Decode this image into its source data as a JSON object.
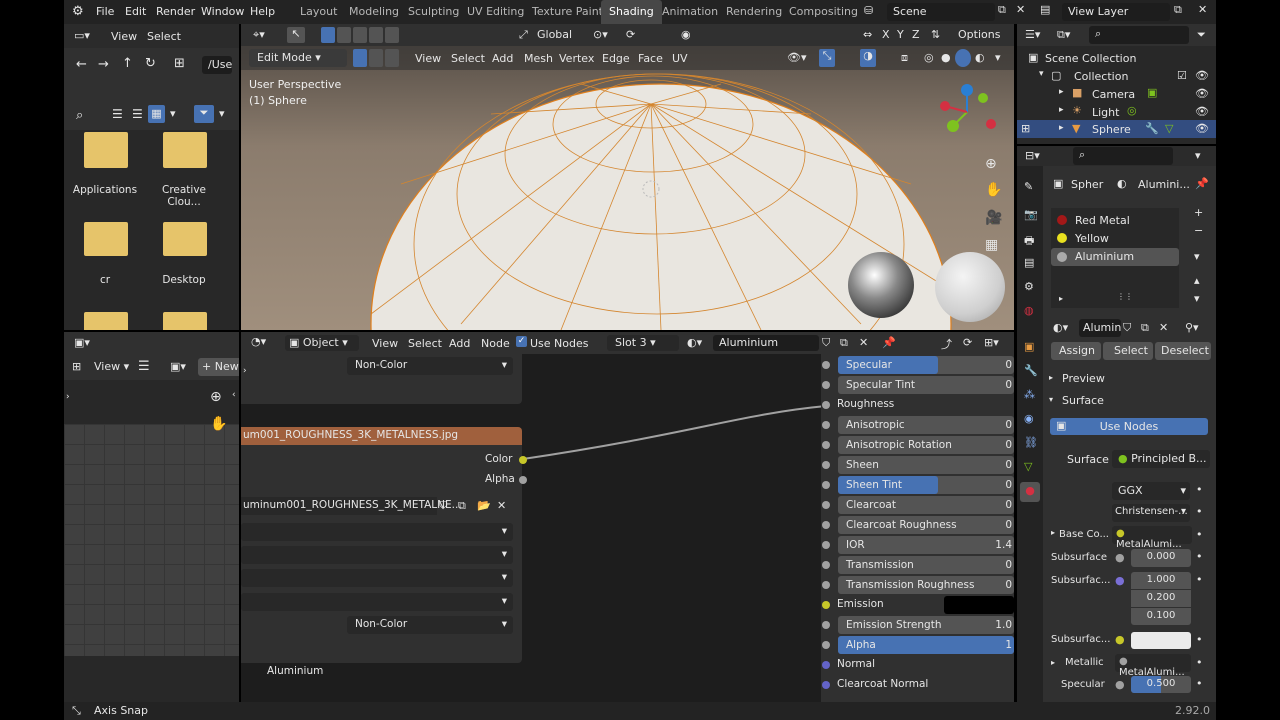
{
  "menus": [
    "File",
    "Edit",
    "Render",
    "Window",
    "Help"
  ],
  "workspaces": [
    "Layout",
    "Modeling",
    "Sculpting",
    "UV Editing",
    "Texture Paint",
    "Shading",
    "Animation",
    "Rendering",
    "Compositing"
  ],
  "scene": "Scene",
  "view_layer": "View Layer",
  "filebrowser": {
    "view": "View",
    "select": "Select",
    "path": "/Use",
    "folders": [
      "Applications",
      "Creative Clou...",
      "cr",
      "Desktop"
    ]
  },
  "viewport": {
    "mode": "Edit Mode",
    "orientation": "Global",
    "options": "Options",
    "menus": [
      "View",
      "Select",
      "Add",
      "Mesh",
      "Vertex",
      "Edge",
      "Face",
      "UV"
    ],
    "info1": "User Perspective",
    "info2": "(1) Sphere"
  },
  "outliner": {
    "root": "Scene Collection",
    "collection": "Collection",
    "items": [
      "Camera",
      "Light",
      "Sphere"
    ]
  },
  "node_editor": {
    "object": "Object",
    "menus": [
      "View",
      "Select",
      "Add",
      "Node"
    ],
    "use_nodes": "Use Nodes",
    "slot": "Slot 3",
    "material": "Aluminium",
    "noncolor1": "Non-Color",
    "image_node_title": "um001_ROUGHNESS_3K_METALNESS.jpg",
    "color_out": "Color",
    "alpha_out": "Alpha",
    "image_name": "uminum001_ROUGHNESS_3K_METALNE...",
    "noncolor2": "Non-Color",
    "material_label": "Aluminium",
    "bsdf_rows": [
      {
        "label": "Specular",
        "value": "0",
        "type": "slider"
      },
      {
        "label": "Specular Tint",
        "value": "0",
        "type": "slider"
      },
      {
        "label": "Roughness",
        "value": "",
        "type": "socket"
      },
      {
        "label": "Anisotropic",
        "value": "0",
        "type": "slider"
      },
      {
        "label": "Anisotropic Rotation",
        "value": "0",
        "type": "slider"
      },
      {
        "label": "Sheen",
        "value": "0",
        "type": "slider"
      },
      {
        "label": "Sheen Tint",
        "value": "0",
        "type": "slider"
      },
      {
        "label": "Clearcoat",
        "value": "0",
        "type": "slider"
      },
      {
        "label": "Clearcoat Roughness",
        "value": "0",
        "type": "slider"
      },
      {
        "label": "IOR",
        "value": "1.4",
        "type": "slider"
      },
      {
        "label": "Transmission",
        "value": "0",
        "type": "slider"
      },
      {
        "label": "Transmission Roughness",
        "value": "0",
        "type": "slider"
      },
      {
        "label": "Emission",
        "value": "",
        "type": "color"
      },
      {
        "label": "Emission Strength",
        "value": "1.0",
        "type": "slider"
      },
      {
        "label": "Alpha",
        "value": "1",
        "type": "slider"
      },
      {
        "label": "Normal",
        "value": "",
        "type": "socket"
      },
      {
        "label": "Clearcoat Normal",
        "value": "",
        "type": "socket"
      }
    ]
  },
  "image_editor": {
    "view": "View",
    "new": "New"
  },
  "properties": {
    "object": "Spher",
    "material": "Alumini...",
    "slots": [
      "Red Metal",
      "Yellow",
      "Aluminium"
    ],
    "mat_name": "Alumin",
    "assign": "Assign",
    "select": "Select",
    "deselect": "Deselect",
    "preview": "Preview",
    "surface_section": "Surface",
    "use_nodes": "Use Nodes",
    "surface_label": "Surface",
    "surface_value": "Principled B...",
    "ggx": "GGX",
    "christensen": "Christensen-...",
    "base_color_label": "Base Co...",
    "base_color_value": "MetalAlumi...",
    "subsurface_label": "Subsurface",
    "subsurface_value": "0.000",
    "subsurface_radius_label": "Subsurfac...",
    "radius": [
      "1.000",
      "0.200",
      "0.100"
    ],
    "subsurface_color_label": "Subsurfac...",
    "metallic_label": "Metallic",
    "metallic_value": "MetalAlumi...",
    "specular_label": "Specular",
    "specular_value": "0.500"
  },
  "status": {
    "left": "Axis Snap",
    "version": "2.92.0"
  }
}
